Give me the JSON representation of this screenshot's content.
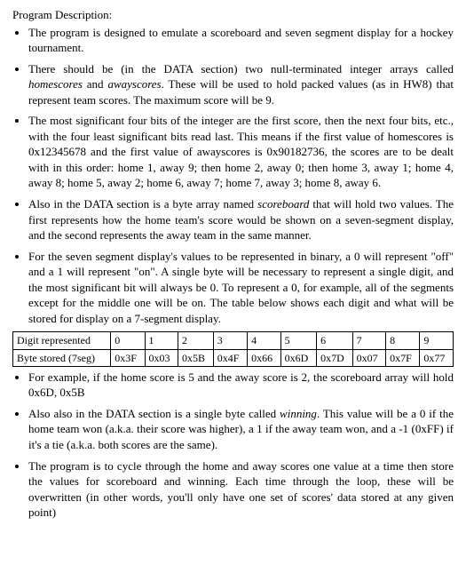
{
  "heading": "Program Description:",
  "bullets_a": [
    "The program is designed to emulate a scoreboard and seven segment display for a hockey tournament.",
    "There should be (in the DATA section) two null-terminated integer arrays called <span class=\"ital\">homescores</span> and <span class=\"ital\">awayscores</span>.  These will be used to hold packed values (as in HW8) that represent team scores.  The maximum score will be 9.",
    "The most significant four bits of the integer are the first score, then the next four bits, etc., with the four least significant bits read last.  This means if the first value of homescores is 0x12345678 and the first value of awayscores is 0x90182736, the scores are to be dealt with in this order: home 1, away 9; then home 2, away 0; then home 3, away 1; home 4, away 8; home 5, away 2; home 6, away 7; home 7, away 3; home 8, away 6.",
    "Also in the DATA section is a byte array named <span class=\"ital\">scoreboard</span> that will hold two values.  The first represents how the home team's score would be shown on a seven-segment display, and the second represents the away team in the same manner.",
    "For the seven segment display's values to be represented in binary, a 0 will represent \"off\" and a 1 will represent \"on\".  A single byte will be necessary to represent a single digit, and the most significant bit will always be 0.  To represent a 0, for example, all of the segments except for the middle one will be on.  The table below shows each digit and what will be stored for display on a 7-segment display."
  ],
  "table": {
    "row1_label": "Digit represented",
    "row1_cells": [
      "0",
      "1",
      "2",
      "3",
      "4",
      "5",
      "6",
      "7",
      "8",
      "9"
    ],
    "row2_label": "Byte stored (7seg)",
    "row2_cells": [
      "0x3F",
      "0x03",
      "0x5B",
      "0x4F",
      "0x66",
      "0x6D",
      "0x7D",
      "0x07",
      "0x7F",
      "0x77"
    ]
  },
  "bullets_b": [
    "For example, if the home score is 5 and the away score is 2, the scoreboard array will hold 0x6D, 0x5B",
    "Also also in the DATA section is a single byte called <span class=\"ital\">winning</span>.  This value will be a 0 if the home team won (a.k.a. their score was higher), a 1 if the away team won, and a -1 (0xFF) if it's a tie (a.k.a. both scores are the same).",
    "The program is to cycle through the home and away scores one value at a time then store the values for scoreboard and winning.  Each time through the loop, these will be overwritten (in other words, you'll only have one set of scores' data stored at any given point)"
  ]
}
